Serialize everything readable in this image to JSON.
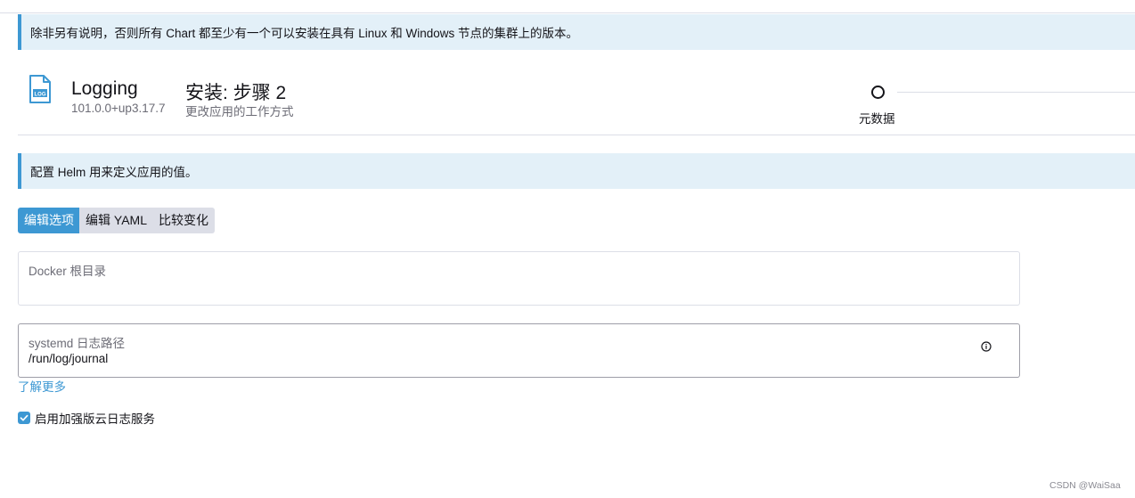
{
  "notice": {
    "os_text": "除非另有说明，否则所有 Chart 都至少有一个可以安装在具有 Linux 和 Windows 节点的集群上的版本。",
    "helm_text": "配置 Helm 用来定义应用的值。"
  },
  "app": {
    "name": "Logging",
    "version": "101.0.0+up3.17.7",
    "icon": "log-file-icon",
    "icon_text": "LOG"
  },
  "step": {
    "title": "安装: 步骤 2",
    "subtitle": "更改应用的工作方式"
  },
  "stepper": {
    "label": "元数据"
  },
  "tabs": [
    {
      "label": "编辑选项",
      "active": true
    },
    {
      "label": "编辑 YAML",
      "active": false
    },
    {
      "label": "比较变化",
      "active": false
    }
  ],
  "fields": {
    "docker_root": {
      "label": "Docker 根目录",
      "value": ""
    },
    "systemd_log_path": {
      "label": "systemd 日志路径",
      "value": "/run/log/journal"
    }
  },
  "learn_more": "了解更多",
  "enhanced_logging": {
    "label": "启用加强版云日志服务",
    "checked": true
  },
  "watermark": "CSDN @WaiSaa",
  "colors": {
    "accent": "#3d98d3",
    "banner_bg": "#e3f0f8",
    "border": "#dcdee7"
  }
}
